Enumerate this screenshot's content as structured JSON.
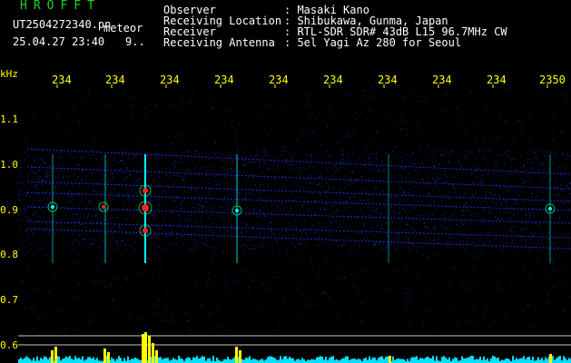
{
  "header": {
    "app_title": "HROFFT",
    "filename": "UT2504272340.pn",
    "tag": "meteor",
    "datetime": "25.04.27 23:40",
    "count": "9.."
  },
  "info": {
    "labels": [
      "Observer",
      "Receiving Location",
      "Receiver",
      "Receiving Antenna"
    ],
    "values": [
      ": Masaki Kano",
      ": Shibukawa, Gunma, Japan",
      ": RTL-SDR SDR# 43dB L15 96.7MHz CW",
      ": 5el Yagi Az 280 for Seoul"
    ]
  },
  "axes": {
    "y_unit": "kHz",
    "y_ticks": [
      "1.1",
      "1.0",
      "0.9",
      "0.8",
      "0.7",
      "0.6"
    ],
    "x_ticks": [
      "234",
      "234",
      "234",
      "234",
      "234",
      "234",
      "234",
      "234",
      "234",
      "2350"
    ]
  },
  "colors": {
    "background": "#000000",
    "header_green": "#1fd51f",
    "text_white": "#ffffff",
    "axis_yellow": "#ffff00",
    "noise_blue": "#1a3cff",
    "trace_cyan": "#00ffff",
    "hot_red": "#ff2020",
    "histogram_cyan": "#00e0ff",
    "histogram_yellow": "#ffff00"
  }
}
